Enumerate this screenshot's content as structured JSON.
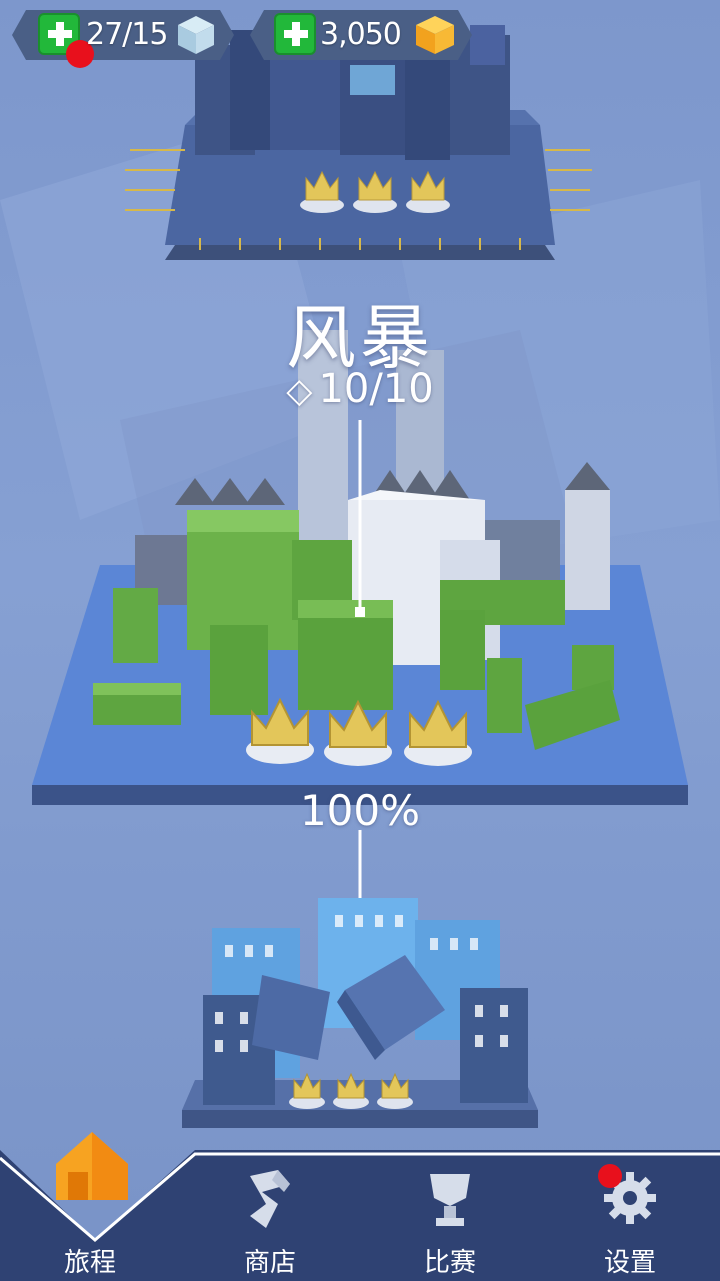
{
  "hud": {
    "lives": "27/15",
    "coins": "3,050",
    "colors": {
      "plus": "#22b83a",
      "alert": "#e8101c",
      "pill": "#4a5f86"
    },
    "icons": [
      "plus-icon",
      "ice-cube-icon",
      "gold-cube-icon"
    ]
  },
  "level": {
    "title": "风暴",
    "gem_progress": "10/10",
    "gem_icon": "diamond-icon",
    "completion": "100%",
    "crowns_earned": 3
  },
  "nav": {
    "items": [
      {
        "label": "旅程",
        "icon": "house-icon",
        "active": true
      },
      {
        "label": "商店",
        "icon": "shop-icon",
        "active": false
      },
      {
        "label": "比赛",
        "icon": "trophy-icon",
        "active": false
      },
      {
        "label": "设置",
        "icon": "gear-icon",
        "active": false
      }
    ]
  }
}
